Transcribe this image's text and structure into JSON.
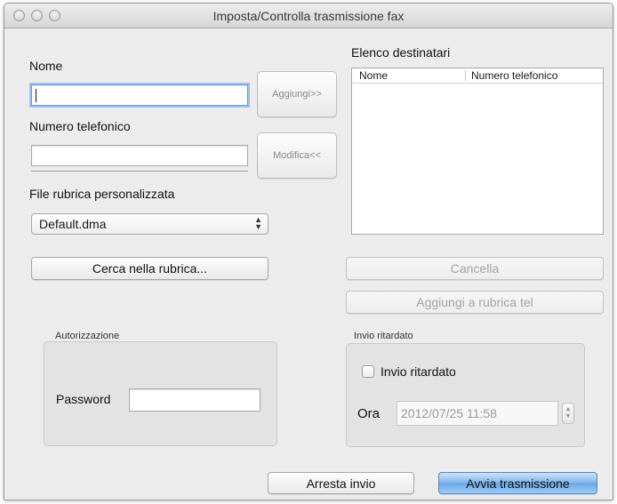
{
  "window": {
    "title": "Imposta/Controlla trasmissione fax"
  },
  "left": {
    "name_label": "Nome",
    "name_value": "",
    "phone_label": "Numero telefonico",
    "phone_value": "",
    "add_button": "Aggiungi>>",
    "modify_button": "Modifica<<",
    "phonebook_file_label": "File rubrica personalizzata",
    "phonebook_file_selected": "Default.dma",
    "search_button": "Cerca nella rubrica..."
  },
  "recipients": {
    "label": "Elenco destinatari",
    "columns": [
      "Nome",
      "Numero telefonico"
    ],
    "rows": [],
    "delete_button": "Cancella",
    "add_to_phonebook_button": "Aggiungi a rubrica tel"
  },
  "authorization": {
    "group_label": "Autorizzazione",
    "password_label": "Password",
    "password_value": ""
  },
  "delayed": {
    "group_label": "Invio ritardato",
    "checkbox_label": "Invio ritardato",
    "checked": false,
    "time_label": "Ora",
    "time_value": "2012/07/25 11:58"
  },
  "footer": {
    "stop_button": "Arresta invio",
    "start_button": "Avvia trasmissione"
  },
  "colors": {
    "window_bg": "#ececec",
    "primary_button": "#7fb4ea",
    "focus_ring": "#9fc0ee"
  }
}
